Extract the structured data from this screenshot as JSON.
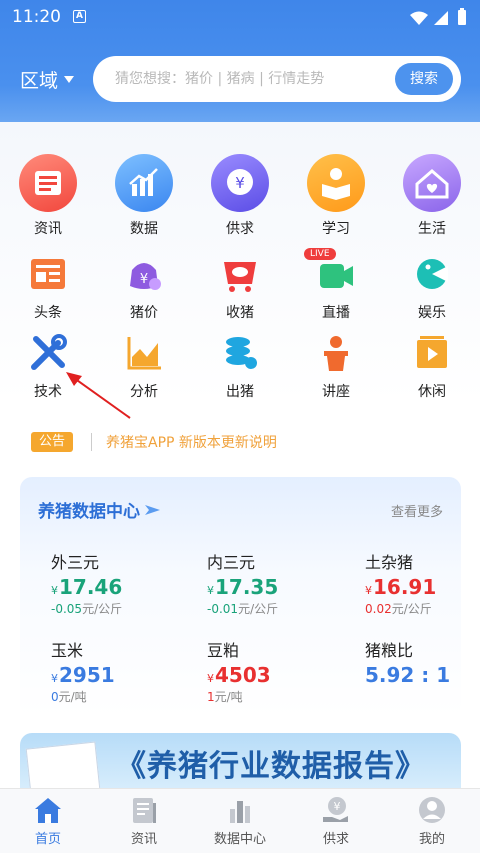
{
  "status": {
    "time": "11:20"
  },
  "header": {
    "region": "区域",
    "search_placeholder": "猜您想搜：猪价 | 猪病 | 行情走势",
    "search_button": "搜索"
  },
  "grid": [
    {
      "label": "资讯",
      "icon": "news-icon"
    },
    {
      "label": "数据",
      "icon": "data-chart-icon"
    },
    {
      "label": "供求",
      "icon": "supply-demand-icon"
    },
    {
      "label": "学习",
      "icon": "study-book-icon"
    },
    {
      "label": "生活",
      "icon": "life-home-icon"
    },
    {
      "label": "头条",
      "icon": "headline-icon"
    },
    {
      "label": "猪价",
      "icon": "pig-price-icon"
    },
    {
      "label": "收猪",
      "icon": "buy-pig-icon"
    },
    {
      "label": "直播",
      "icon": "live-video-icon",
      "badge": "LIVE"
    },
    {
      "label": "娱乐",
      "icon": "entertainment-icon"
    },
    {
      "label": "技术",
      "icon": "wrench-tools-icon"
    },
    {
      "label": "分析",
      "icon": "analysis-chart-icon"
    },
    {
      "label": "出猪",
      "icon": "sell-pig-icon"
    },
    {
      "label": "讲座",
      "icon": "lecture-podium-icon"
    },
    {
      "label": "休闲",
      "icon": "leisure-play-icon"
    }
  ],
  "notice": {
    "tag": "公告",
    "text": "养猪宝APP 新版本更新说明"
  },
  "data_center": {
    "title": "养猪数据中心",
    "more": "查看更多",
    "metrics": [
      {
        "name": "外三元",
        "currency": "¥",
        "price": "17.46",
        "change_value": "-0.05",
        "unit": "元/公斤",
        "color": "#1aa37a"
      },
      {
        "name": "内三元",
        "currency": "¥",
        "price": "17.35",
        "change_value": "-0.01",
        "unit": "元/公斤",
        "color": "#1aa37a"
      },
      {
        "name": "土杂猪",
        "currency": "¥",
        "price": "16.91",
        "change_value": "0.02",
        "unit": "元/公斤",
        "color": "#e83030"
      },
      {
        "name": "玉米",
        "currency": "¥",
        "price": "2951",
        "change_value": "0",
        "unit": "元/吨",
        "color": "#3a7be0"
      },
      {
        "name": "豆粕",
        "currency": "¥",
        "price": "4503",
        "change_value": "1",
        "unit": "元/吨",
        "color": "#e83030"
      },
      {
        "name": "猪粮比",
        "currency": "",
        "price": "5.92 : 1",
        "change_value": "",
        "unit": "",
        "color": "#3a7be0"
      }
    ]
  },
  "banner": {
    "text": "《养猪行业数据报告》"
  },
  "nav": [
    {
      "label": "首页",
      "icon": "home-icon",
      "active": true
    },
    {
      "label": "资讯",
      "icon": "news-doc-icon",
      "active": false
    },
    {
      "label": "数据中心",
      "icon": "bar-chart-icon",
      "active": false
    },
    {
      "label": "供求",
      "icon": "yuan-hand-icon",
      "active": false
    },
    {
      "label": "我的",
      "icon": "profile-icon",
      "active": false
    }
  ]
}
